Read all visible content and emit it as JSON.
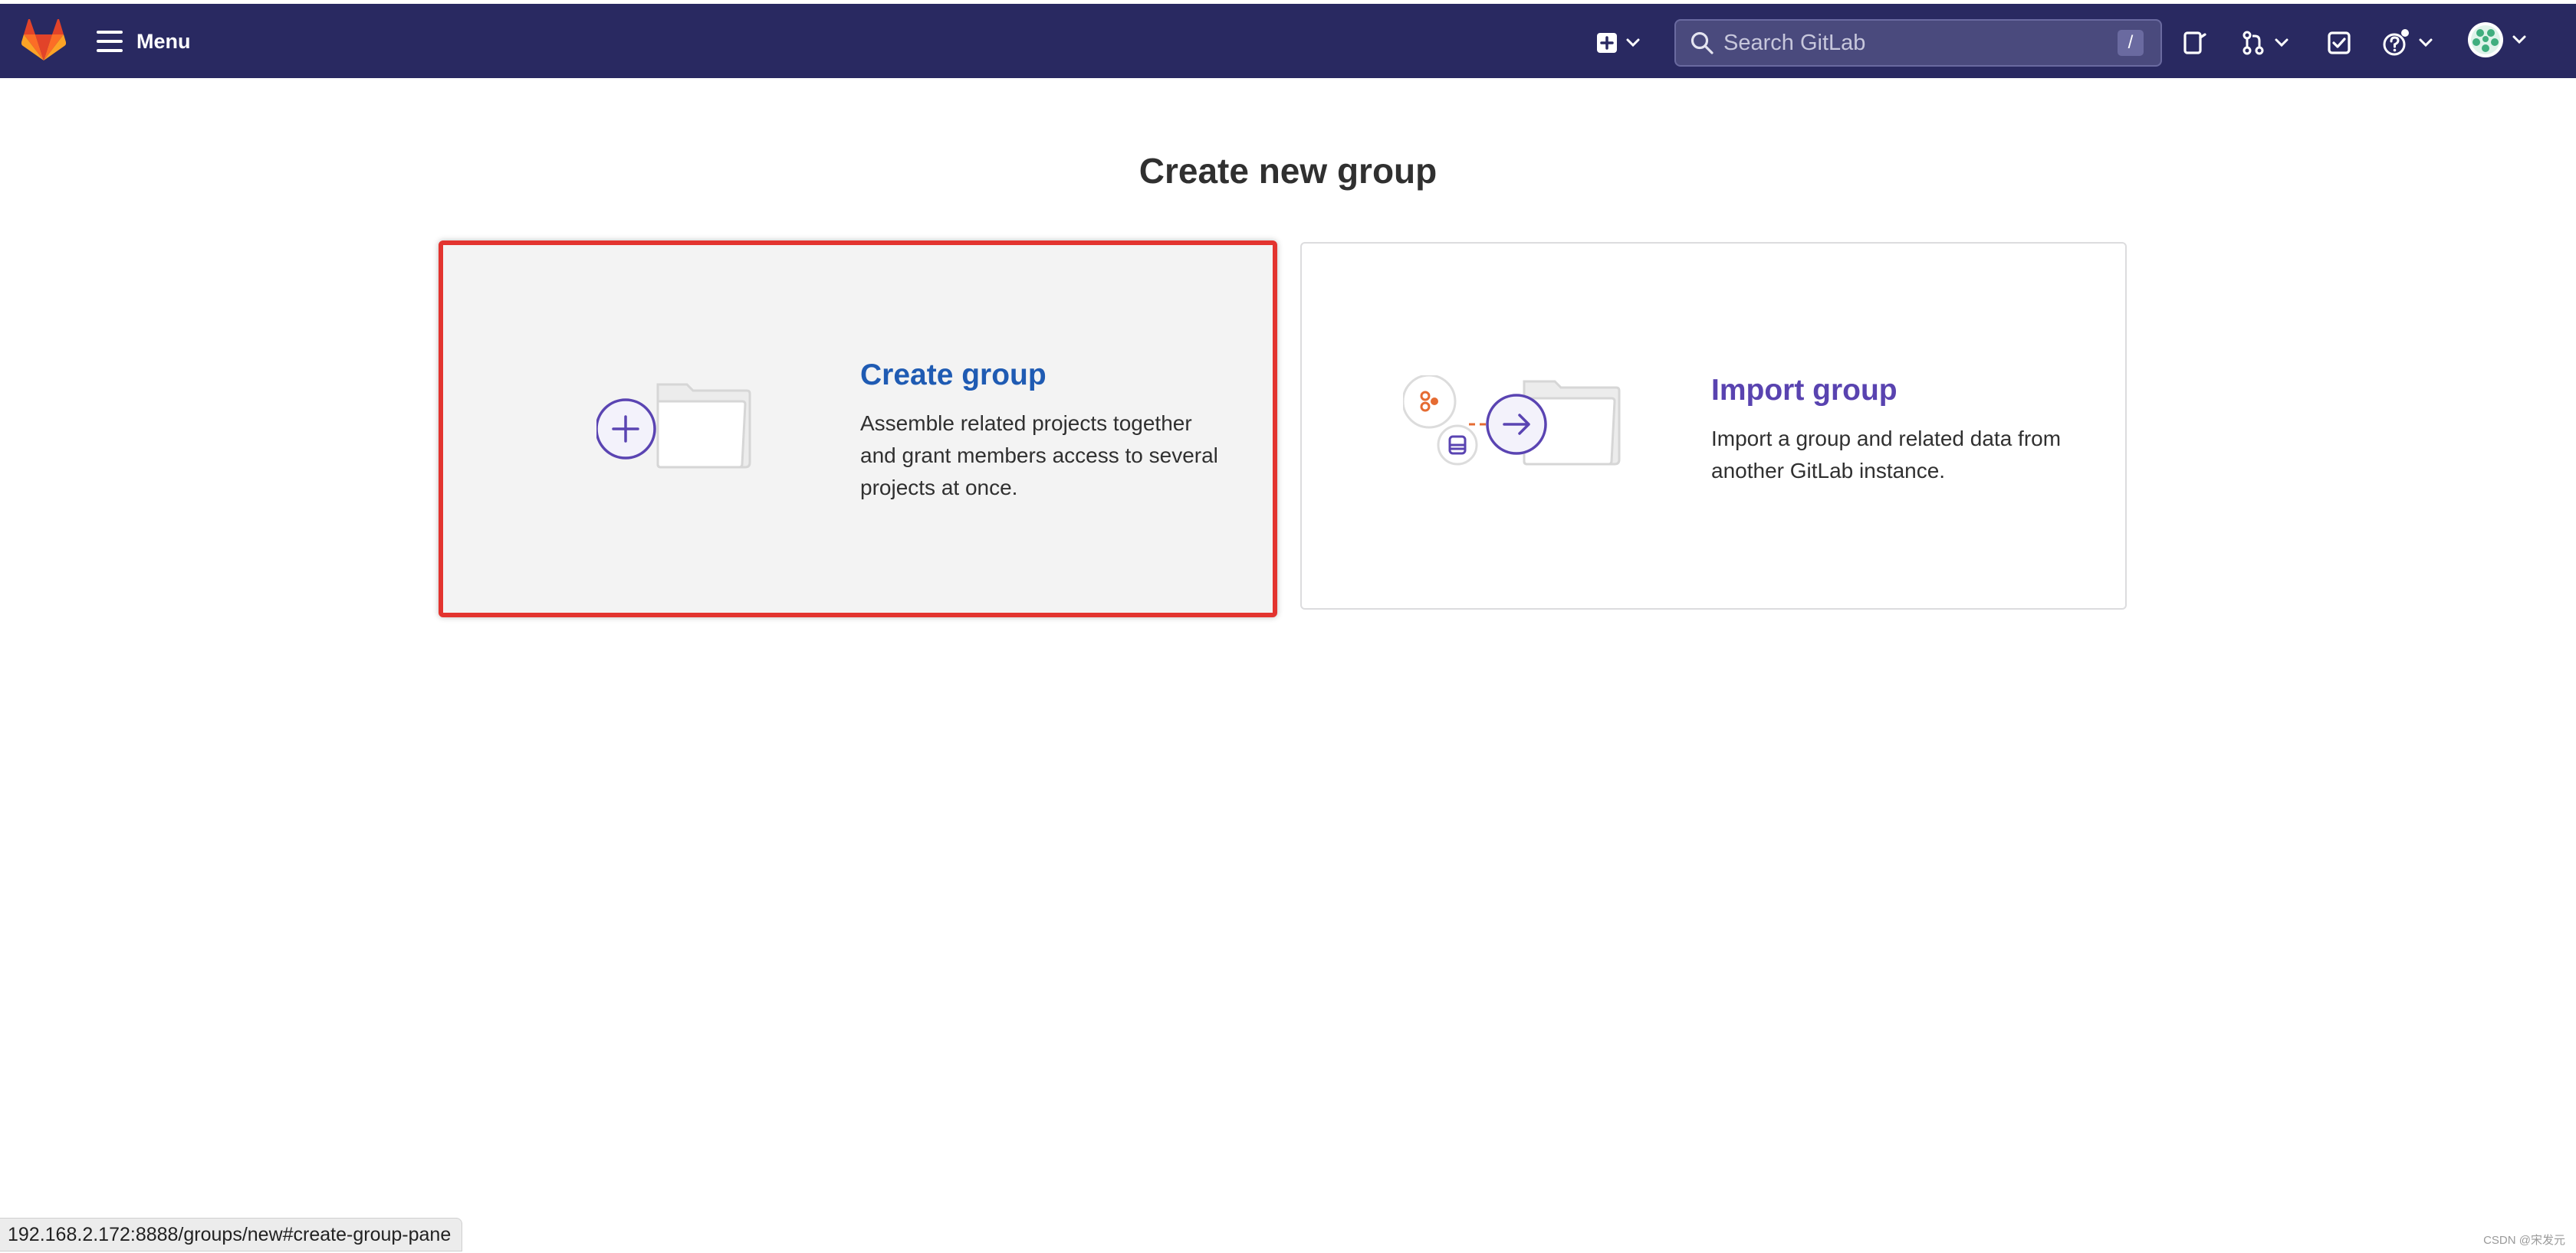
{
  "topbar": {
    "menu_label": "Menu",
    "search_placeholder": "Search GitLab",
    "search_shortcut": "/",
    "bg_color": "#292961"
  },
  "page": {
    "title": "Create new group"
  },
  "cards": {
    "create": {
      "title": "Create group",
      "description": "Assemble related projects together and grant members access to several projects at once.",
      "title_color": "#1f5bb3",
      "highlight_color": "#e3342f"
    },
    "import": {
      "title": "Import group",
      "description": "Import a group and related data from another GitLab instance.",
      "title_color": "#5943b0"
    }
  },
  "statusbar": {
    "url": "192.168.2.172:8888/groups/new#create-group-pane"
  },
  "watermark": "CSDN @宋发元"
}
